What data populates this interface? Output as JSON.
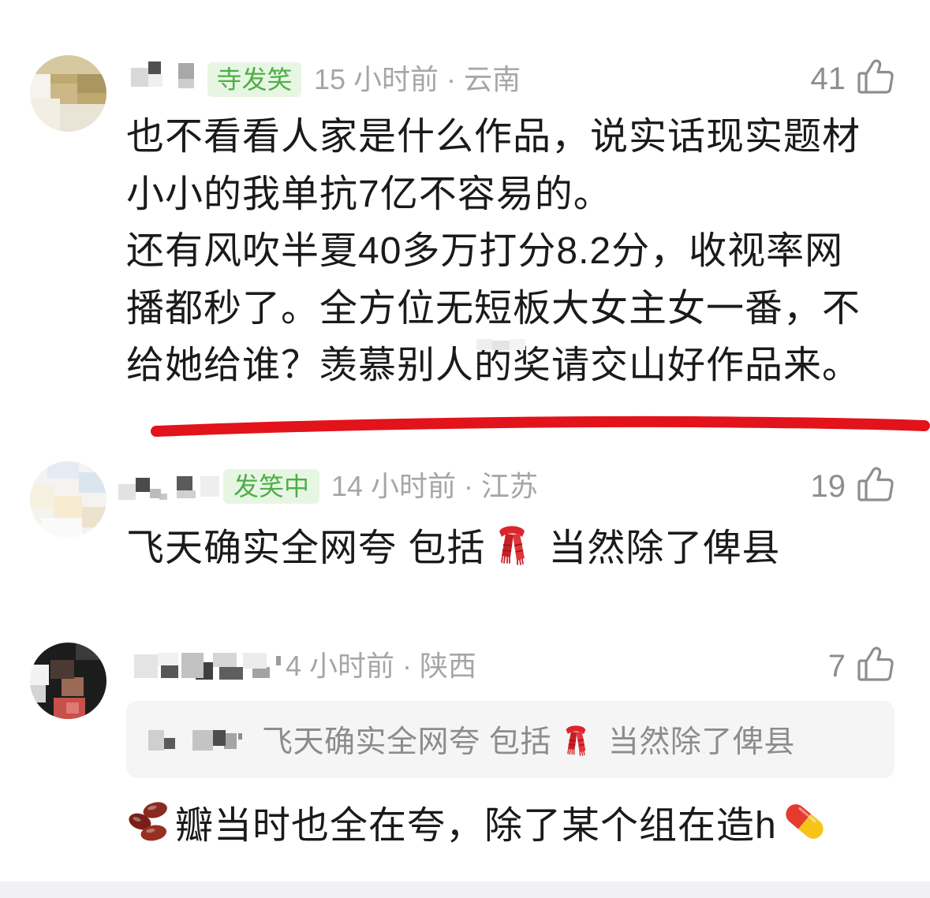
{
  "colors": {
    "text": "#1a1a1a",
    "meta": "#a6a6a6",
    "like": "#8e8e8e",
    "badge_text": "#4fae48",
    "badge_bg": "#e7f6e3",
    "quote_bg": "#f5f5f5",
    "quote_text": "#8c8c8c",
    "annotation": "#e2131b"
  },
  "icons": {
    "like": "thumbs-up-icon",
    "scarf": "scarf-emoji-icon",
    "beans": "beans-emoji-icon",
    "pill": "pill-emoji-icon"
  },
  "comments": [
    {
      "badge": "寺发笑",
      "time": "15 小时前 · 云南",
      "likes": "41",
      "body_lines": [
        "也不看看人家是什么作品，说实话现实题材",
        "小小的我单抗7亿不容易的。",
        "还有风吹半夏40多万打分8.2分，收视率网",
        "播都秒了。全方位无短板大女主女一番，不",
        "给她给谁？羡慕别人的奖请交山好作品来。"
      ]
    },
    {
      "badge": "发笑中",
      "time": "14 小时前 · 江苏",
      "likes": "19",
      "body": {
        "before_icon": "飞天确实全网夸 包括",
        "icon": "scarf-emoji-icon",
        "after_icon": "当然除了俾县"
      }
    },
    {
      "time": "4 小时前 · 陕西",
      "likes": "7",
      "quote": {
        "before_icon": "飞天确实全网夸 包括",
        "icon": "scarf-emoji-icon",
        "after_icon": "当然除了俾县"
      },
      "body": {
        "lead_icon": "beans-emoji-icon",
        "text": "瓣当时也全在夸，除了某个组在造h",
        "trail_icon": "pill-emoji-icon"
      }
    }
  ]
}
